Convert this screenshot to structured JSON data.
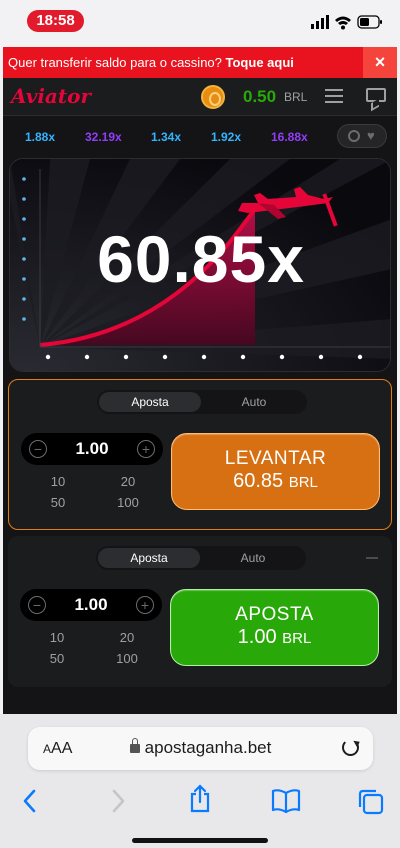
{
  "status_bar": {
    "time": "18:58"
  },
  "promo": {
    "text": "Quer transferir saldo para o cassino?",
    "link": "Toque aqui",
    "close": "×"
  },
  "header": {
    "logo": "Aviator",
    "balance": "0.50",
    "currency": "BRL"
  },
  "history": {
    "values": [
      "1.88x",
      "32.19x",
      "1.34x",
      "1.92x",
      "16.88x"
    ],
    "colors": [
      "#34b4ff",
      "#913ef8",
      "#34b4ff",
      "#34b4ff",
      "#913ef8"
    ]
  },
  "game": {
    "multiplier": "60.85x"
  },
  "bet1": {
    "tab_bet": "Aposta",
    "tab_auto": "Auto",
    "amount": "1.00",
    "quick": [
      "10",
      "20",
      "50",
      "100"
    ],
    "action_label": "LEVANTAR",
    "action_value": "60.85",
    "action_currency": "BRL"
  },
  "bet2": {
    "tab_bet": "Aposta",
    "tab_auto": "Auto",
    "amount": "1.00",
    "quick": [
      "10",
      "20",
      "50",
      "100"
    ],
    "action_label": "APOSTA",
    "action_value": "1.00",
    "action_currency": "BRL"
  },
  "browser": {
    "aa": "AA",
    "url": "apostaganha.bet"
  },
  "colors": {
    "accent_red": "#e50539",
    "cashout_orange": "#d77013",
    "bet_green": "#28a909",
    "balance_green": "#28a909"
  }
}
